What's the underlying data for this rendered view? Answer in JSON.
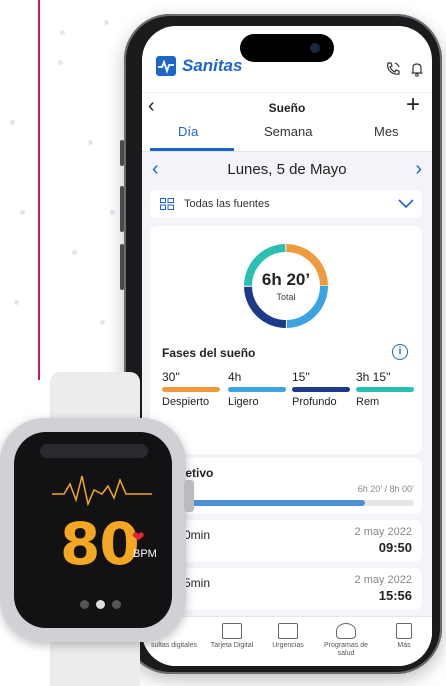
{
  "app": {
    "brand": "Sanitas",
    "screen_title": "Sueño",
    "tabs": [
      {
        "label": "Día",
        "active": true
      },
      {
        "label": "Semana",
        "active": false
      },
      {
        "label": "Mes",
        "active": false
      }
    ]
  },
  "date_nav": {
    "date": "Lunes, 5 de Mayo"
  },
  "sources": {
    "label": "Todas las fuentes"
  },
  "summary": {
    "total_value": "6h 20’",
    "total_label": "Total",
    "ring_segments": [
      {
        "phase": "Despierto",
        "color": "#f09a3e"
      },
      {
        "phase": "Ligero",
        "color": "#3aa3e0"
      },
      {
        "phase": "Profundo",
        "color": "#1b3a8a"
      },
      {
        "phase": "Rem",
        "color": "#2bbfb3"
      }
    ]
  },
  "phases": {
    "title": "Fases del sueño",
    "items": [
      {
        "value": "30''",
        "name": "Despierto",
        "color": "#f09a3e"
      },
      {
        "value": "4h",
        "name": "Ligero",
        "color": "#3aa3e0"
      },
      {
        "value": "15''",
        "name": "Profundo",
        "color": "#1b3a8a"
      },
      {
        "value": "3h 15''",
        "name": "Rem",
        "color": "#2bbfb3"
      }
    ]
  },
  "objective": {
    "title": "jetivo",
    "percent": "%",
    "progress_text": "6h 20’ / 8h 00’",
    "progress_fraction": 0.79
  },
  "records": [
    {
      "duration": "0min",
      "date": "2 may 2022",
      "time": "09:50"
    },
    {
      "duration": "5min",
      "date": "2 may 2022",
      "time": "15:56"
    }
  ],
  "bottom_nav": [
    {
      "label": "sultas digitales",
      "icon": "chat-icon"
    },
    {
      "label": "Tarjeta Digital",
      "icon": "card-icon"
    },
    {
      "label": "Urgencias",
      "icon": "ambulance-icon"
    },
    {
      "label": "Programas de salud",
      "icon": "heart-program-icon"
    },
    {
      "label": "Más",
      "icon": "grid-icon"
    }
  ],
  "watch": {
    "bpm_value": "80",
    "bpm_label": "BPM"
  },
  "colors": {
    "brand_blue": "#1c66c9",
    "accent_magenta": "#c2186b",
    "watch_orange": "#f5a623",
    "heart_red": "#e52536"
  }
}
